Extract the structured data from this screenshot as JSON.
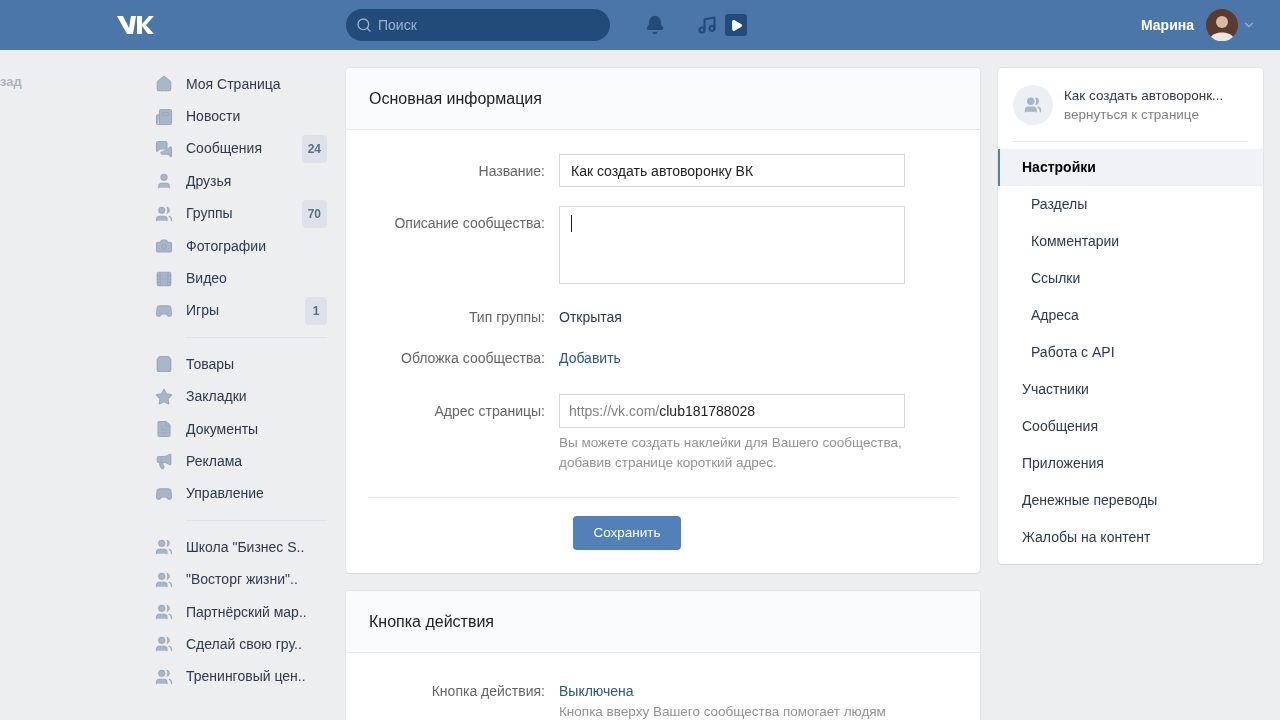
{
  "header": {
    "search": {
      "placeholder": "Поиск"
    },
    "user_name": "Марина"
  },
  "back_link": "зад",
  "nav": [
    [
      {
        "label": "Моя Страница",
        "kind": "home"
      },
      {
        "label": "Новости",
        "kind": "news"
      },
      {
        "label": "Сообщения",
        "kind": "messages",
        "badge": "24"
      },
      {
        "label": "Друзья",
        "kind": "friends"
      },
      {
        "label": "Группы",
        "kind": "groups",
        "badge": "70"
      },
      {
        "label": "Фотографии",
        "kind": "photos"
      },
      {
        "label": "Видео",
        "kind": "video"
      },
      {
        "label": "Игры",
        "kind": "games",
        "badge": "1"
      }
    ],
    [
      {
        "label": "Товары",
        "kind": "market"
      },
      {
        "label": "Закладки",
        "kind": "bookmarks"
      },
      {
        "label": "Документы",
        "kind": "docs"
      },
      {
        "label": "Реклама",
        "kind": "ads"
      },
      {
        "label": "Управление",
        "kind": "manage"
      }
    ],
    [
      {
        "label": "Школа \"Бизнес S..",
        "kind": "groups"
      },
      {
        "label": "\"Восторг жизни\"..",
        "kind": "groups"
      },
      {
        "label": "Партнёрский мар..",
        "kind": "groups"
      },
      {
        "label": "Сделай свою гру..",
        "kind": "groups"
      },
      {
        "label": "Тренинговый цен..",
        "kind": "groups"
      }
    ]
  ],
  "main_card": {
    "title": "Основная информация",
    "rows": [
      {
        "kind": "input",
        "label": "Название:",
        "value": "Как создать автоворонку ВК"
      },
      {
        "kind": "textarea",
        "label": "Описание сообщества:"
      },
      {
        "kind": "text",
        "label": "Тип группы:",
        "value": "Открытая"
      },
      {
        "kind": "link",
        "label": "Обложка сообщества:",
        "value": "Добавить"
      },
      {
        "kind": "address",
        "label": "Адрес страницы:",
        "prefix": "https://vk.com/",
        "value": "club181788028",
        "hint": "Вы можете создать наклейки для Вашего сообщества, добавив странице короткий адрес."
      }
    ],
    "save_button": "Сохранить"
  },
  "action_card": {
    "title": "Кнопка действия",
    "rows": [
      {
        "kind": "link",
        "label": "Кнопка действия:",
        "value": "Выключена",
        "hint": "Кнопка вверху Вашего сообщества помогает людям"
      }
    ]
  },
  "side_menu": {
    "community_name": "Как создать автоворонк...",
    "back_text": "вернуться к странице",
    "items": [
      {
        "label": "Настройки",
        "selected": true,
        "children": [
          {
            "label": "Разделы",
            "selected": false
          },
          {
            "label": "Комментарии",
            "selected": false
          },
          {
            "label": "Ссылки",
            "selected": false
          },
          {
            "label": "Адреса",
            "selected": false
          },
          {
            "label": "Работа с API",
            "selected": false
          }
        ]
      },
      {
        "label": "Участники",
        "selected": false
      },
      {
        "label": "Сообщения",
        "selected": false
      },
      {
        "label": "Приложения",
        "selected": false
      },
      {
        "label": "Денежные переводы",
        "selected": false
      },
      {
        "label": "Жалобы на контент",
        "selected": false
      }
    ]
  }
}
